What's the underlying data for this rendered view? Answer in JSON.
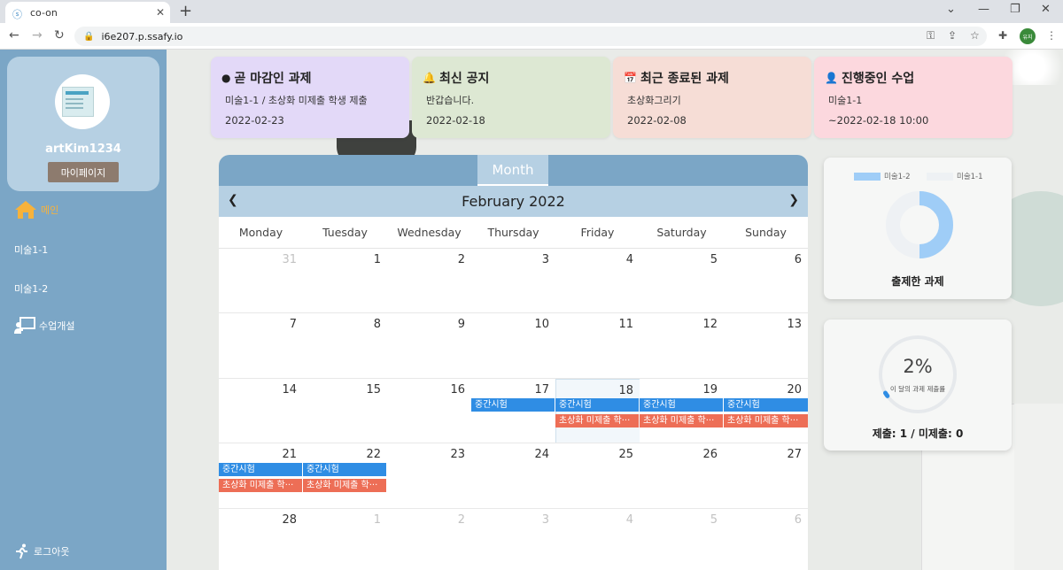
{
  "browser": {
    "tab_title": "co-on",
    "url": "i6e207.p.ssafy.io",
    "profile_label": "유지"
  },
  "sidebar": {
    "username": "artKim1234",
    "mypage_label": "마이페이지",
    "items": [
      {
        "label": "메인",
        "icon": "home-icon"
      },
      {
        "label": "미술1-1"
      },
      {
        "label": "미술1-2"
      },
      {
        "label": "수업개설",
        "icon": "teacher-board-icon"
      }
    ],
    "logout_label": "로그아웃"
  },
  "cards": [
    {
      "title": "곧 마감인 과제",
      "icon": "clock-icon",
      "line1": "미술1-1 / 초상화 미제출 학생 제출",
      "line2": "2022-02-23",
      "color": "#e3d9f8"
    },
    {
      "title": "최신 공지",
      "icon": "bell-icon",
      "line1": "반갑습니다.",
      "line2": "2022-02-18",
      "color": "#dde8d3"
    },
    {
      "title": "최근 종료된 과제",
      "icon": "calendar-check-icon",
      "line1": "초상화그리기",
      "line2": "2022-02-08",
      "color": "#f6ddd6"
    },
    {
      "title": "진행중인 수업",
      "icon": "chalkboard-user-icon",
      "line1": "미술1-1",
      "line2": "~2022-02-18 10:00",
      "color": "#fcd8de"
    }
  ],
  "calendar": {
    "view_tab": "Month",
    "month_title": "February 2022",
    "weekdays": [
      "Monday",
      "Tuesday",
      "Wednesday",
      "Thursday",
      "Friday",
      "Saturday",
      "Sunday"
    ],
    "weeks": [
      [
        "31",
        "1",
        "2",
        "3",
        "4",
        "5",
        "6"
      ],
      [
        "7",
        "8",
        "9",
        "10",
        "11",
        "12",
        "13"
      ],
      [
        "14",
        "15",
        "16",
        "17",
        "18",
        "19",
        "20"
      ],
      [
        "21",
        "22",
        "23",
        "24",
        "25",
        "26",
        "27"
      ],
      [
        "28",
        "1",
        "2",
        "3",
        "4",
        "5",
        "6"
      ]
    ],
    "events": {
      "exam": "중간시험",
      "portrait": "초상화 미제출 학···"
    }
  },
  "chart_card": {
    "legend": [
      "미술1-2",
      "미술1-1"
    ],
    "title": "출제한 과제",
    "colors": {
      "series1": "#9fcdf7",
      "series2": "#eef1f4"
    }
  },
  "submit_card": {
    "percent": "2%",
    "subtitle": "이 달의 과제 제출률",
    "summary": "제출: 1 / 미제출: 0",
    "progress": 0.02
  }
}
